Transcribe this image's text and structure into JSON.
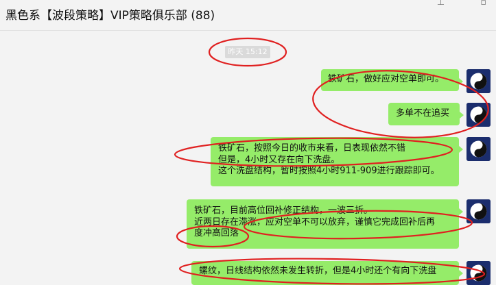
{
  "window": {
    "title": "黑色系【波段策略】VIP策略俱乐部 (88)",
    "icons": [
      "pin-icon",
      "more-icon"
    ]
  },
  "chat": {
    "timestamp": "昨天 15:12",
    "messages": [
      {
        "lines": [
          "铁矿石，做好应对空单即可。"
        ]
      },
      {
        "lines": [
          "多单不在追买"
        ]
      },
      {
        "lines": [
          "铁矿石，按照今日的收市来看，日表现依然不错",
          "但是，4小时又存在向下洗盘。",
          "这个洗盘结构，暂时按照4小时911-909进行跟踪即可。"
        ]
      },
      {
        "lines": [
          "铁矿石，目前高位回补修正结构，一波三折。",
          "近两日存在滞涨，应对空单不可以放弃，谨慎它完成回补后再",
          "度冲高回落"
        ]
      },
      {
        "lines": [
          "螺纹，日线结构依然未发生转折，但是4小时还个有向下洗盘"
        ]
      }
    ]
  },
  "colors": {
    "bubble": "#95ec69",
    "annotation": "#e02020",
    "background": "#f3f3f3"
  }
}
